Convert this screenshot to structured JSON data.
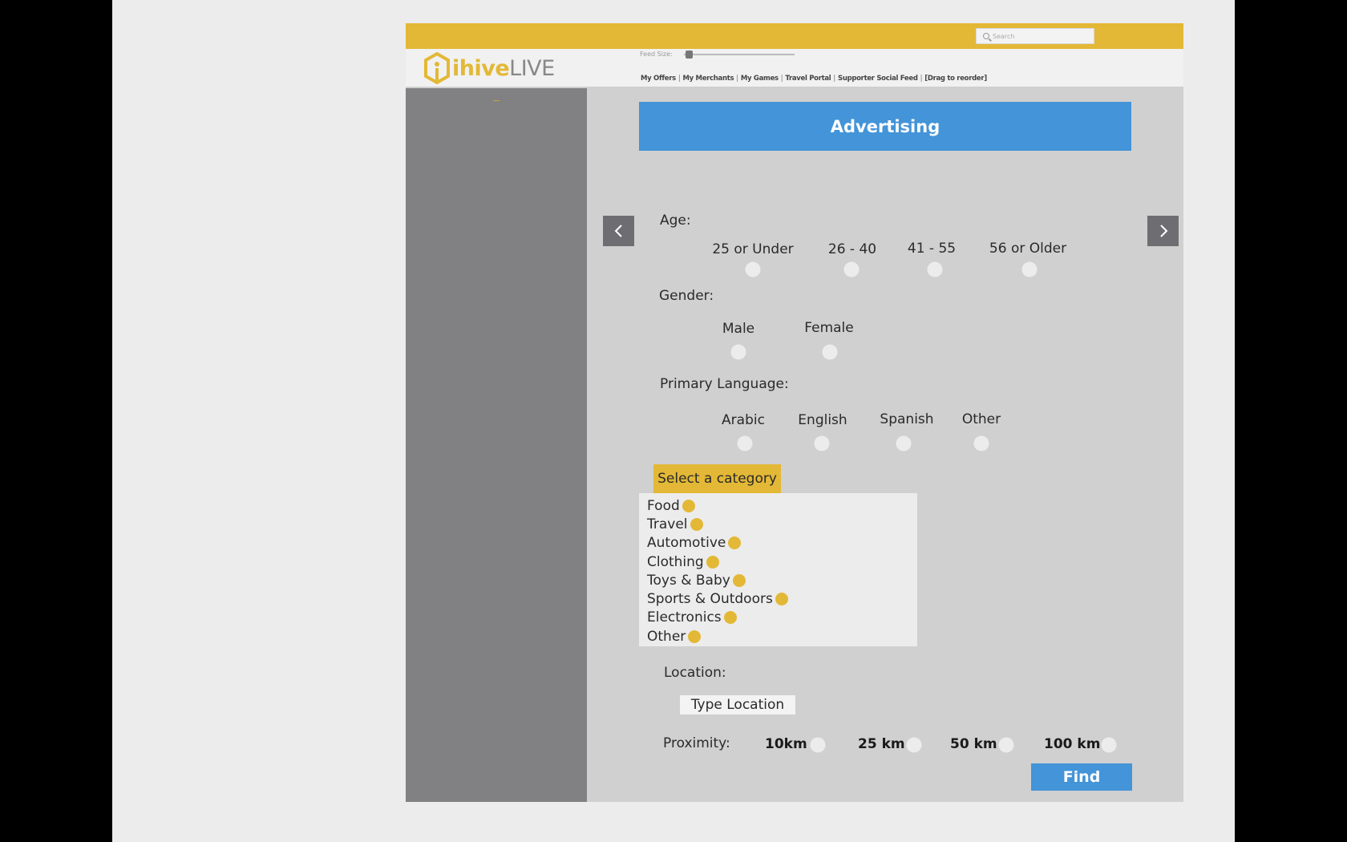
{
  "topbar": {
    "search_placeholder": "Search"
  },
  "header": {
    "logo_primary": "ihive",
    "logo_secondary": "LIVE",
    "feed_size_label": "Feed Size:",
    "nav": [
      "My Offers",
      "My Merchants",
      "My Games",
      "Travel Portal",
      "Supporter Social Feed",
      "[Drag to reorder]"
    ]
  },
  "main": {
    "banner_title": "Advertising",
    "age": {
      "label": "Age:",
      "options": [
        "25 or Under",
        "26 - 40",
        "41 - 55",
        "56 or Older"
      ]
    },
    "gender": {
      "label": "Gender:",
      "options": [
        "Male",
        "Female"
      ]
    },
    "language": {
      "label": "Primary Language:",
      "options": [
        "Arabic",
        "English",
        "Spanish",
        "Other"
      ]
    },
    "category": {
      "button_label": "Select a category",
      "items": [
        "Food",
        "Travel",
        "Automotive",
        "Clothing",
        "Toys & Baby",
        "Sports & Outdoors",
        "Electronics",
        "Other"
      ]
    },
    "location": {
      "label": "Location:",
      "placeholder": "Type Location"
    },
    "proximity": {
      "label": "Proximity:",
      "options": [
        "10km",
        "25 km",
        "50 km",
        "100 km"
      ]
    },
    "find_label": "Find"
  },
  "colors": {
    "accent": "#e3b836",
    "primary": "#4394d8",
    "sidebar": "#818184"
  }
}
